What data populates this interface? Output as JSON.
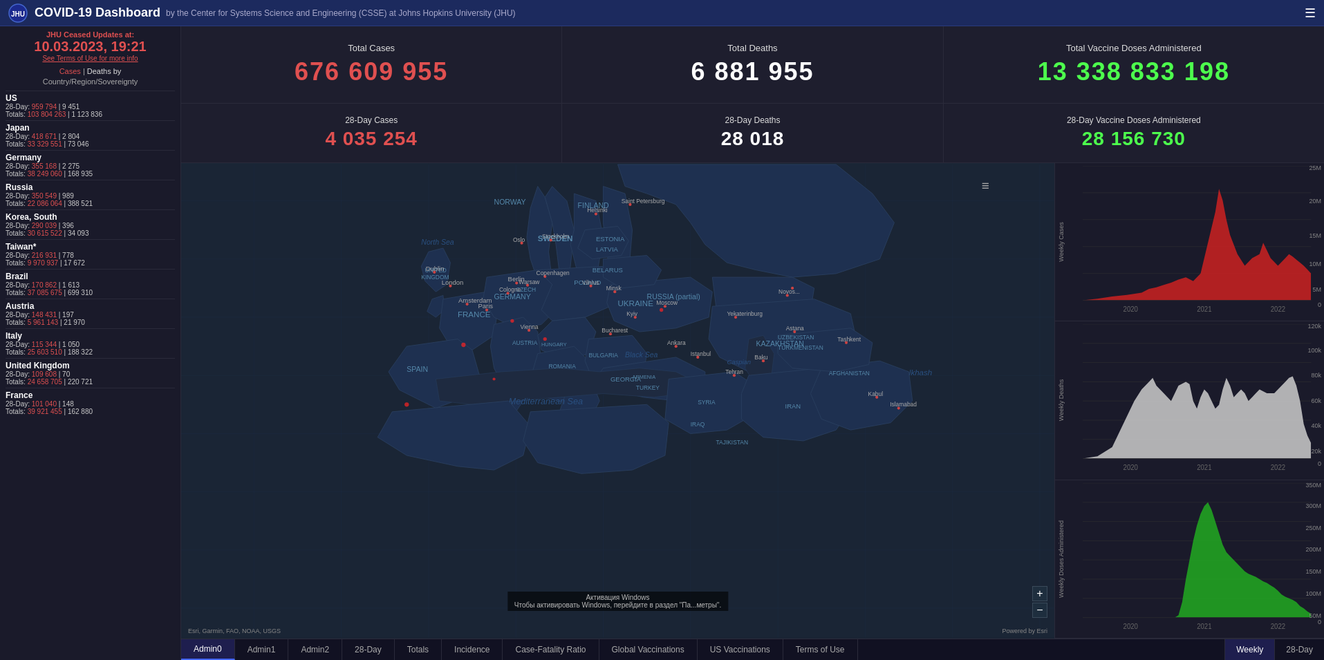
{
  "header": {
    "title": "COVID-19 Dashboard",
    "subtitle": "by the Center for Systems Science and Engineering (CSSE) at Johns Hopkins University (JHU)",
    "menu_icon": "☰"
  },
  "jhu_notice": {
    "title": "JHU Ceased Updates at:",
    "date": "10.03.2023, 19:21",
    "link": "See Terms of Use for more info"
  },
  "sidebar_header": {
    "cases_label": "Cases",
    "sep": " | ",
    "deaths_label": "Deaths by",
    "sub": "Country/Region/Sovereignty"
  },
  "stats": {
    "total_cases_label": "Total Cases",
    "total_cases_value": "676 609 955",
    "total_deaths_label": "Total Deaths",
    "total_deaths_value": "6 881 955",
    "total_vaccine_label": "Total Vaccine Doses Administered",
    "total_vaccine_value": "13 338 833 198",
    "day28_cases_label": "28-Day Cases",
    "day28_cases_value": "4 035 254",
    "day28_deaths_label": "28-Day Deaths",
    "day28_deaths_value": "28 018",
    "day28_vaccine_label": "28-Day Vaccine Doses Administered",
    "day28_vaccine_value": "28 156 730"
  },
  "countries": [
    {
      "name": "US",
      "day28_cases": "959 794",
      "day28_deaths": "9 451",
      "total_cases": "103 804 263",
      "total_deaths": "1 123 836"
    },
    {
      "name": "Japan",
      "day28_cases": "418 671",
      "day28_deaths": "2 804",
      "total_cases": "33 329 551",
      "total_deaths": "73 046"
    },
    {
      "name": "Germany",
      "day28_cases": "355 168",
      "day28_deaths": "2 275",
      "total_cases": "38 249 060",
      "total_deaths": "168 935"
    },
    {
      "name": "Russia",
      "day28_cases": "350 549",
      "day28_deaths": "989",
      "total_cases": "22 086 064",
      "total_deaths": "388 521"
    },
    {
      "name": "Korea, South",
      "day28_cases": "290 039",
      "day28_deaths": "396",
      "total_cases": "30 615 522",
      "total_deaths": "34 093"
    },
    {
      "name": "Taiwan*",
      "day28_cases": "216 931",
      "day28_deaths": "778",
      "total_cases": "9 970 937",
      "total_deaths": "17 672"
    },
    {
      "name": "Brazil",
      "day28_cases": "170 862",
      "day28_deaths": "1 613",
      "total_cases": "37 085 675",
      "total_deaths": "699 310"
    },
    {
      "name": "Austria",
      "day28_cases": "148 431",
      "day28_deaths": "197",
      "total_cases": "5 961 143",
      "total_deaths": "21 970"
    },
    {
      "name": "Italy",
      "day28_cases": "115 344",
      "day28_deaths": "1 050",
      "total_cases": "25 603 510",
      "total_deaths": "188 322"
    },
    {
      "name": "United Kingdom",
      "day28_cases": "109 608",
      "day28_deaths": "70",
      "total_cases": "24 658 705",
      "total_deaths": "220 721"
    },
    {
      "name": "France",
      "day28_cases": "101 040",
      "day28_deaths": "148",
      "total_cases": "39 921 455",
      "total_deaths": "162 880"
    }
  ],
  "charts": {
    "weekly_cases_label": "Weekly Cases",
    "weekly_deaths_label": "Weekly Deaths",
    "weekly_vaccine_label": "Weekly Doses Administered",
    "x_labels": [
      "2020",
      "2021",
      "2022"
    ],
    "cases_y_labels": [
      "25M",
      "20M",
      "15M",
      "10M",
      "5M",
      "0"
    ],
    "deaths_y_labels": [
      "120k",
      "100k",
      "80k",
      "60k",
      "40k",
      "20k",
      "0"
    ],
    "vaccine_y_labels": [
      "350M",
      "300M",
      "250M",
      "200M",
      "150M",
      "100M",
      "50M",
      "0"
    ]
  },
  "map": {
    "attribution": "Esri, Garmin, FAO, NOAA, USGS",
    "powered": "Powered by Esri",
    "zoom_in": "+",
    "zoom_out": "−"
  },
  "bottom_tabs": {
    "left": [
      "Admin0",
      "Admin1",
      "Admin2",
      "28-Day",
      "Totals",
      "Incidence",
      "Case-Fatality Ratio",
      "Global Vaccinations",
      "US Vaccinations",
      "Terms of Use"
    ],
    "right": [
      "Weekly",
      "28-Day"
    ]
  },
  "watermark": {
    "line1": "Активация Windows",
    "line2": "Чтобы активировать Windows, перейдите в раздел \"Па...метры\"."
  }
}
